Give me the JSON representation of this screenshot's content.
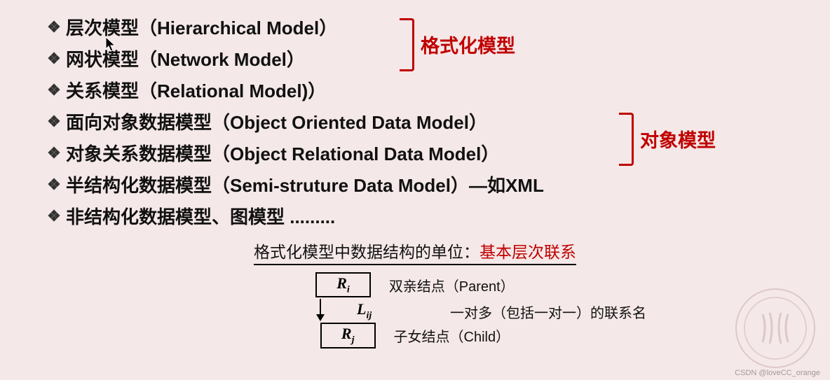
{
  "bullets": {
    "b1": "层次模型（Hierarchical Model）",
    "b2": "网状模型（Network Model）",
    "b3": "关系模型（Relational Model)）",
    "b4": "面向对象数据模型（Object Oriented Data Model）",
    "b5": "对象关系数据模型（Object Relational Data Model）",
    "b6": "半结构化数据模型（Semi-struture Data Model）—如XML",
    "b7": "非结构化数据模型、图模型 ........."
  },
  "group_labels": {
    "g1": "格式化模型",
    "g2": "对象模型"
  },
  "caption": {
    "prefix": "格式化模型中数据结构的单位：",
    "highlight": "基本层次联系"
  },
  "figure": {
    "parent_node": "R",
    "parent_sub": "i",
    "child_node": "R",
    "child_sub": "j",
    "edge": "L",
    "edge_sub": "ij",
    "parent_desc": "双亲结点（Parent）",
    "edge_desc": "一对多（包括一对一）的联系名",
    "child_desc": "子女结点（Child）"
  },
  "watermark": "CSDN @loveCC_orange"
}
